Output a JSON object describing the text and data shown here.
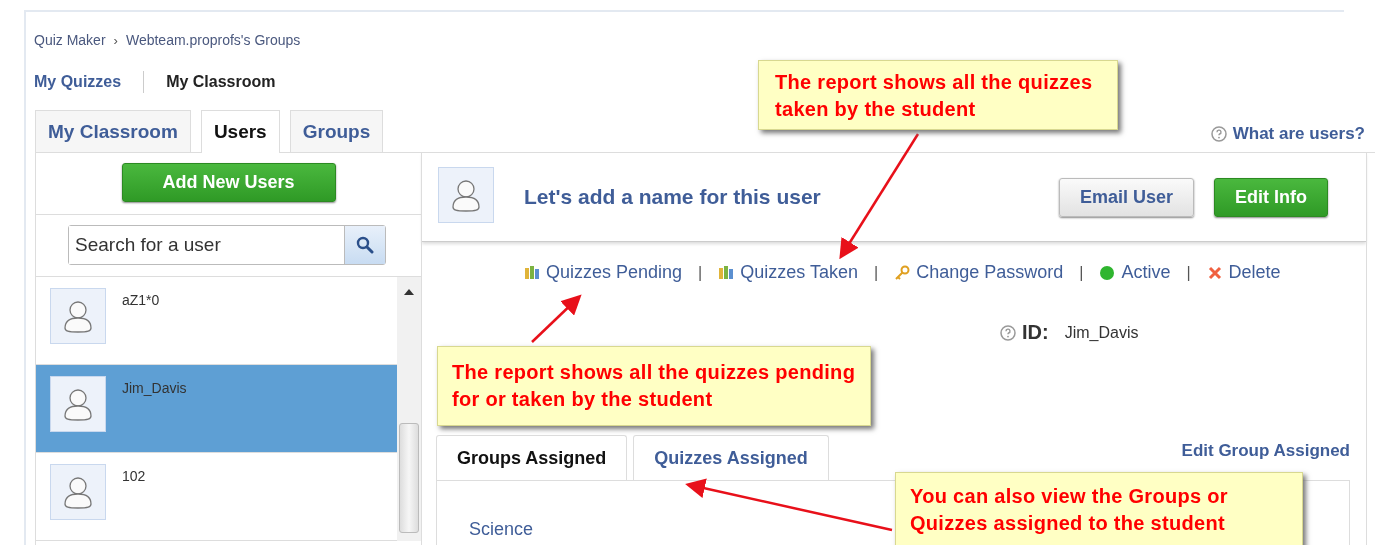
{
  "breadcrumb": {
    "items": [
      "Quiz Maker",
      "Webteam.proprofs's Groups"
    ],
    "separator": "›"
  },
  "nav_links": [
    {
      "label": "My Quizzes",
      "selected": false
    },
    {
      "label": "My Classroom",
      "selected": true
    }
  ],
  "tabs": [
    {
      "label": "My Classroom",
      "selected": false
    },
    {
      "label": "Users",
      "selected": true
    },
    {
      "label": "Groups",
      "selected": false
    }
  ],
  "help_link": "What are users?",
  "add_button": "Add New Users",
  "search": {
    "placeholder": "Search for a user"
  },
  "users": [
    {
      "name": "aZ1*0",
      "selected": false
    },
    {
      "name": "Jim_Davis",
      "selected": true
    },
    {
      "name": "102",
      "selected": false
    }
  ],
  "profile": {
    "name_prompt": "Let's add a name for this user",
    "buttons": [
      {
        "label": "Email User",
        "kind": "secondary"
      },
      {
        "label": "Edit Info",
        "kind": "primary"
      }
    ],
    "actions": [
      {
        "kind": "books",
        "label": "Quizzes Pending"
      },
      {
        "kind": "books",
        "label": "Quizzes Taken"
      },
      {
        "kind": "key",
        "label": "Change Password"
      },
      {
        "kind": "status",
        "label": "Active"
      },
      {
        "kind": "delete",
        "label": "Delete"
      }
    ],
    "action_separator": "|",
    "id_label": "ID:",
    "id_value": "Jim_Davis"
  },
  "sub_tabs": [
    {
      "label": "Groups Assigned",
      "selected": true
    },
    {
      "label": "Quizzes Assigned",
      "selected": false
    }
  ],
  "edit_link": "Edit Group Assigned",
  "groups": [
    "Science"
  ],
  "callouts": [
    {
      "text": "The report shows all the quizzes taken by the student"
    },
    {
      "text": "The report shows all the quizzes pending for or taken by the student"
    },
    {
      "text": "You can also view the Groups or Quizzes assigned to the student"
    }
  ]
}
